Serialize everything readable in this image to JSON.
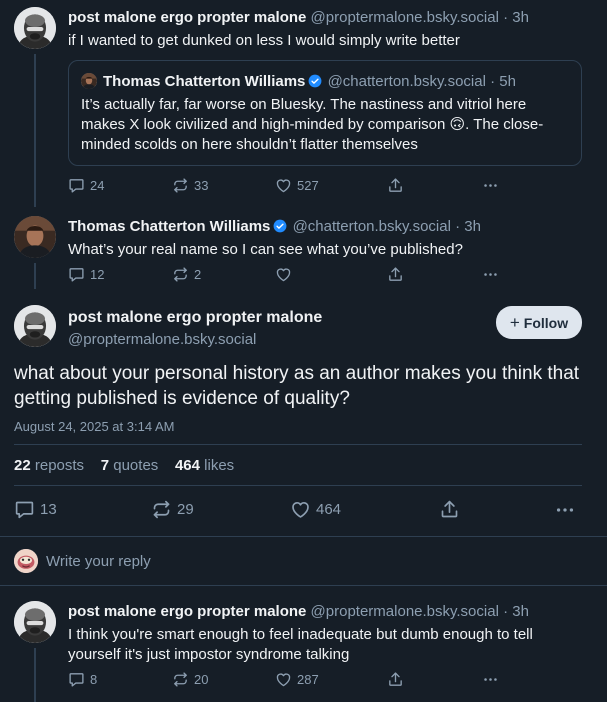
{
  "parent_post": {
    "display_name": "post malone ergo propter malone",
    "handle": "@proptermalone.bsky.social",
    "time": "· 3h",
    "text": "if I wanted to get dunked on less I would simply write better",
    "quote": {
      "display_name": "Thomas Chatterton Williams",
      "handle": "@chatterton.bsky.social",
      "time": "· 5h",
      "text": "It’s actually far, far worse on Bluesky. The nastiness and vitriol here makes X look civilized and high-minded by comparison 🙃. The close-minded scolds on here shouldn’t flatter themselves"
    },
    "replies": "24",
    "reposts": "33",
    "likes": "527"
  },
  "reply_post": {
    "display_name": "Thomas Chatterton Williams",
    "handle": "@chatterton.bsky.social",
    "time": "· 3h",
    "text": "What’s your real name so I can see what you’ve published?",
    "replies": "12",
    "reposts": "2",
    "likes": ""
  },
  "focus_post": {
    "display_name": "post malone ergo propter malone",
    "handle": "@proptermalone.bsky.social",
    "follow_label": "Follow",
    "text": "what about your personal history as an author makes you think that getting published is evidence of quality?",
    "timestamp": "August 24, 2025 at 3:14 AM",
    "reposts_count": "22",
    "reposts_label": "reposts",
    "quotes_count": "7",
    "quotes_label": "quotes",
    "likes_count": "464",
    "likes_label": "likes",
    "replies": "13",
    "reposts": "29",
    "likes": "464"
  },
  "reply_box": {
    "placeholder": "Write your reply"
  },
  "child_post": {
    "display_name": "post malone ergo propter malone",
    "handle": "@proptermalone.bsky.social",
    "time": "· 3h",
    "text": "I think you're smart enough to feel inadequate but dumb enough to tell yourself it's just impostor syndrome talking",
    "replies": "8",
    "reposts": "20",
    "likes": "287"
  },
  "colors": {
    "background": "#161e27",
    "border": "#2e3f51",
    "muted_text": "#8d9fb1",
    "verified": "#208bfe",
    "follow_button": "#dfe6ee"
  },
  "icons": [
    "reply-icon",
    "repost-icon",
    "like-icon",
    "share-icon",
    "more-icon",
    "verified-icon",
    "plus-icon"
  ]
}
